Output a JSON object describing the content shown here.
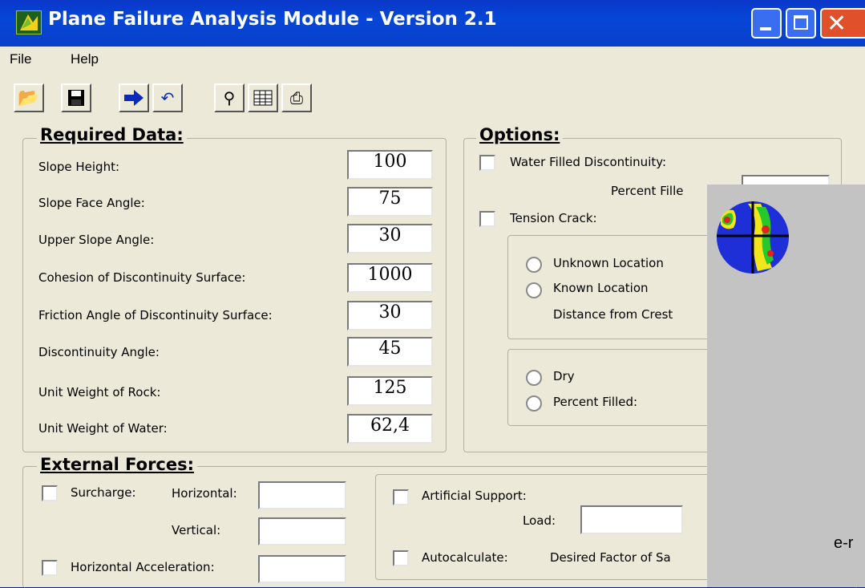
{
  "window": {
    "title": "Plane Failure Analysis Module - Version 2.1"
  },
  "menu": {
    "file": "File",
    "help": "Help"
  },
  "toolbar": {
    "buttons": [
      "open-folder-icon",
      "save-disk-icon",
      "run-arrow-icon",
      "undo-icon",
      "binoculars-icon",
      "table-grid-icon",
      "printer-icon"
    ]
  },
  "required": {
    "title": "Required Data:",
    "rows": [
      {
        "label": "Slope Height:",
        "value": "100"
      },
      {
        "label": "Slope Face Angle:",
        "value": "75"
      },
      {
        "label": "Upper Slope Angle:",
        "value": "30"
      },
      {
        "label": "Cohesion of Discontinuity Surface:",
        "value": "1000"
      },
      {
        "label": "Friction Angle of Discontinuity Surface:",
        "value": "30"
      },
      {
        "label": "Discontinuity Angle:",
        "value": "45"
      },
      {
        "label": "Unit Weight of Rock:",
        "value": "125"
      },
      {
        "label": "Unit Weight of Water:",
        "value": "62,4"
      }
    ]
  },
  "options": {
    "title": "Options:",
    "water_filled": "Water Filled Discontinuity:",
    "percent_filled": "Percent Fille",
    "tension_crack": "Tension Crack:",
    "unknown_location": "Unknown Location",
    "known_location": "Known Location",
    "distance_from_crest": "Distance from Crest",
    "dry": "Dry",
    "percent_filled2": "Percent Filled:"
  },
  "external": {
    "title": "External Forces:",
    "surcharge": "Surcharge:",
    "horizontal": "Horizontal:",
    "vertical": "Vertical:",
    "horizontal_accel": "Horizontal Acceleration:",
    "artificial_support": "Artificial Support:",
    "load": "Load:",
    "autocalculate": "Autocalculate:",
    "desired_fs": "Desired Factor of Sa"
  },
  "overlay": {
    "text": "e-r"
  },
  "colors": {
    "titlebar": "#0546d8",
    "face": "#ece9d8",
    "overlay": "#c3c3c3"
  }
}
